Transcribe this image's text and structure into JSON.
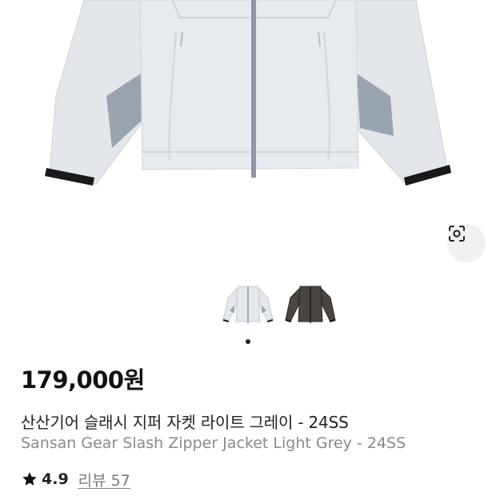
{
  "product": {
    "price": "179,000원",
    "title_ko": "산산기어 슬래시 지퍼 자켓 라이트 그레이 - 24SS",
    "title_en": "Sansan Gear Slash Zipper Jacket Light Grey - 24SS",
    "rating": "4.9",
    "review_label": "리뷰 57"
  },
  "gallery": {
    "thumbnails": [
      {
        "name": "light-grey",
        "color": "#dfe3ea"
      },
      {
        "name": "dark-brown",
        "color": "#4a4540"
      }
    ],
    "lens_icon": "visual-search-icon"
  },
  "colors": {
    "jacket": "#e4e7ec",
    "accent_grey": "#9aa3b0",
    "cuff": "#1a1a1a",
    "secondary_text": "#8a8a8e"
  }
}
